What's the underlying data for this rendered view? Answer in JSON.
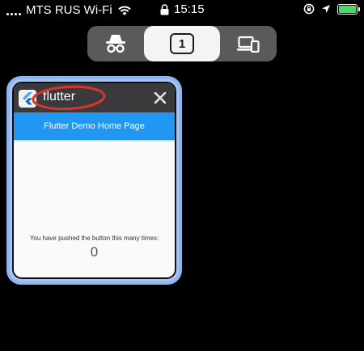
{
  "status_bar": {
    "carrier": "MTS RUS Wi-Fi",
    "time": "15:15",
    "battery_state": "charging",
    "battery_color": "#4cd964",
    "icons": [
      "signal-icon",
      "wifi-icon",
      "lock-icon",
      "orientation-lock-icon",
      "location-arrow-icon",
      "battery-icon"
    ]
  },
  "switcher": {
    "selected": "tabs",
    "tab_count": "1",
    "icons": [
      "private-browsing-icon",
      "tab-count-icon",
      "devices-icon"
    ]
  },
  "tab_card": {
    "title": "flutter",
    "accent": "#8fb5ee",
    "annotation_color": "#d9352a",
    "app": {
      "app_bar_title": "Flutter Demo Home Page",
      "app_bar_color": "#2196f3",
      "message": "You have pushed the button this many times:",
      "counter_value": "0"
    }
  }
}
